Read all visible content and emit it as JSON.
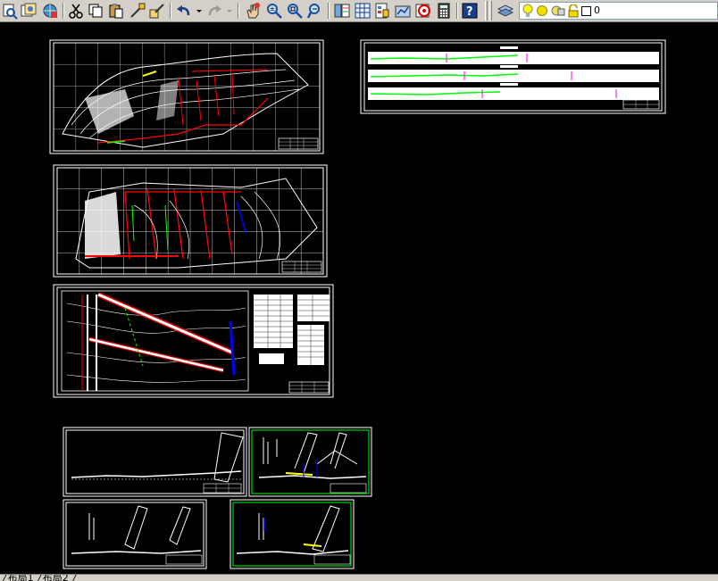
{
  "toolbar": {
    "buttons": [
      {
        "icon": "preview-icon"
      },
      {
        "icon": "publish-icon"
      },
      {
        "icon": "3d-dwf-icon"
      },
      {
        "icon": "cut-icon"
      },
      {
        "icon": "copy-icon"
      },
      {
        "icon": "paste-icon"
      },
      {
        "icon": "match-properties-icon"
      },
      {
        "icon": "block-editor-icon"
      },
      {
        "icon": "undo-icon"
      },
      {
        "icon": "redo-icon"
      },
      {
        "icon": "pan-icon"
      },
      {
        "icon": "zoom-realtime-icon"
      },
      {
        "icon": "zoom-window-icon"
      },
      {
        "icon": "zoom-previous-icon"
      },
      {
        "icon": "properties-icon"
      },
      {
        "icon": "design-center-icon"
      },
      {
        "icon": "tool-palettes-icon"
      },
      {
        "icon": "sheet-set-icon"
      },
      {
        "icon": "markup-icon"
      },
      {
        "icon": "calculator-icon"
      },
      {
        "icon": "help-icon"
      },
      {
        "icon": "layer-manager-icon"
      }
    ],
    "layer": {
      "name": "0",
      "icons": [
        "lightbulb-on-icon",
        "sun-icon",
        "freeze-viewport-icon",
        "lock-icon",
        "color-swatch-icon"
      ],
      "bulb_color": "#ffff00",
      "swatch_color": "#ffffff"
    }
  },
  "drawing": {
    "background": "#000000",
    "colors": {
      "frame": "#ffffff",
      "red": "#ff0000",
      "green": "#00ff00",
      "blue": "#0000ff",
      "magenta": "#ff00ff",
      "yellow": "#ffff00",
      "cyan": "#00ffff"
    },
    "sheets": [
      {
        "id": "sheet-site-plan-1"
      },
      {
        "id": "sheet-profiles"
      },
      {
        "id": "sheet-site-plan-2"
      },
      {
        "id": "sheet-layout-plan"
      },
      {
        "id": "sheet-section-a"
      },
      {
        "id": "sheet-section-b"
      },
      {
        "id": "sheet-section-c"
      },
      {
        "id": "sheet-section-d"
      }
    ]
  },
  "status": {
    "tabs_text": "╱布局1 ╱布局2 ╱"
  }
}
